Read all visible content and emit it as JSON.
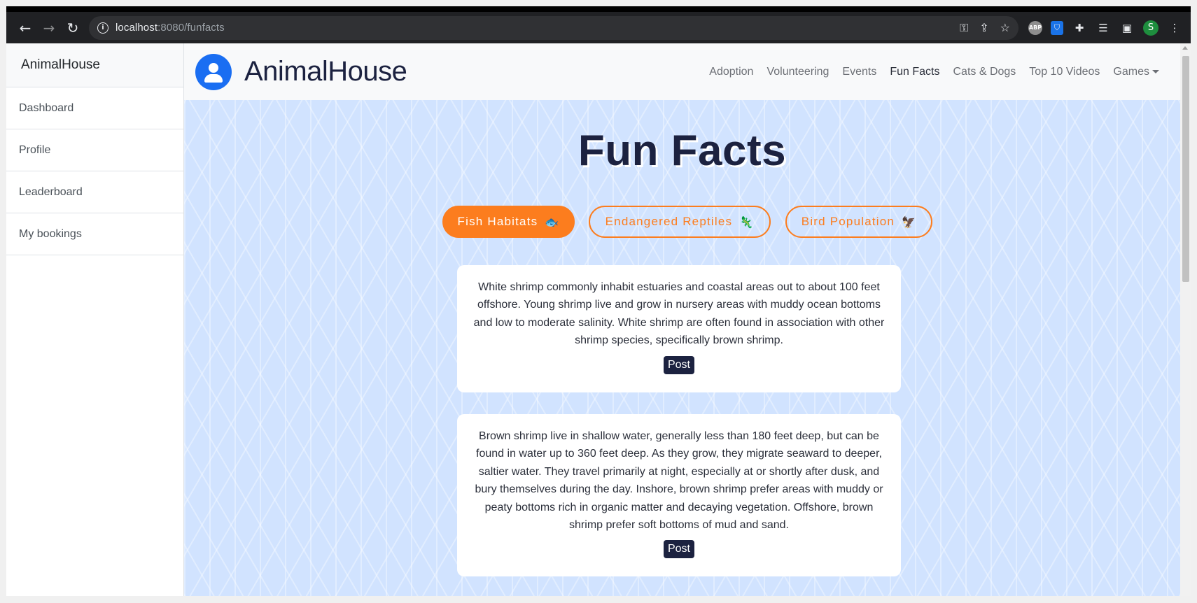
{
  "browser": {
    "url_host": "localhost",
    "url_path": ":8080/funfacts",
    "profile_initial": "S",
    "abp_label": "ABP"
  },
  "sidebar": {
    "title": "AnimalHouse",
    "items": [
      {
        "label": "Dashboard"
      },
      {
        "label": "Profile"
      },
      {
        "label": "Leaderboard"
      },
      {
        "label": "My bookings"
      }
    ]
  },
  "navbar": {
    "brand": "AnimalHouse",
    "links": [
      {
        "label": "Adoption"
      },
      {
        "label": "Volunteering"
      },
      {
        "label": "Events"
      },
      {
        "label": "Fun Facts"
      },
      {
        "label": "Cats & Dogs"
      },
      {
        "label": "Top 10 Videos"
      },
      {
        "label": "Games"
      }
    ]
  },
  "main": {
    "title": "Fun Facts",
    "filters": [
      {
        "label": "Fish Habitats",
        "emoji": "🐟"
      },
      {
        "label": "Endangered Reptiles",
        "emoji": "🦎"
      },
      {
        "label": "Bird Population",
        "emoji": "🦅"
      }
    ],
    "facts": [
      {
        "text": "White shrimp commonly inhabit estuaries and coastal areas out to about 100 feet offshore. Young shrimp live and grow in nursery areas with muddy ocean bottoms and low to moderate salinity. White shrimp are often found in association with other shrimp species, specifically brown shrimp.",
        "button": "Post"
      },
      {
        "text": "Brown shrimp live in shallow water, generally less than 180 feet deep, but can be found in water up to 360 feet deep. As they grow, they migrate seaward to deeper, saltier water. They travel primarily at night, especially at or shortly after dusk, and bury themselves during the day. Inshore, brown shrimp prefer areas with muddy or peaty bottoms rich in organic matter and decaying vegetation. Offshore, brown shrimp prefer soft bottoms of mud and sand.",
        "button": "Post"
      }
    ]
  },
  "colors": {
    "accent": "#fc7d1e",
    "brand_blue": "#1a6ef2",
    "dark_navy": "#1c2240",
    "content_bg": "#d1e3ff"
  }
}
